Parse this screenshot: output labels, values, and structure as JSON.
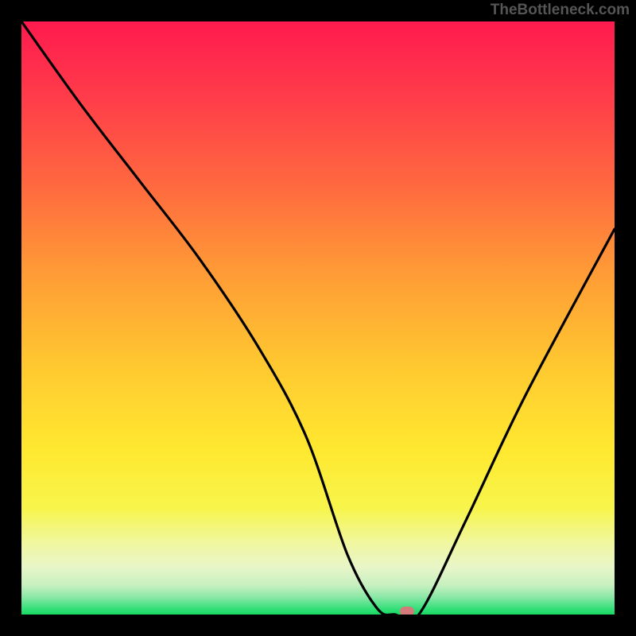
{
  "attribution": "TheBottleneck.com",
  "chart_data": {
    "type": "line",
    "title": "",
    "xlabel": "",
    "ylabel": "",
    "xlim": [
      0,
      100
    ],
    "ylim": [
      0,
      100
    ],
    "x": [
      0,
      10,
      20,
      30,
      40,
      48,
      55,
      60,
      63,
      67,
      75,
      85,
      100
    ],
    "values": [
      100,
      86,
      73,
      60,
      45,
      30,
      10,
      1,
      0,
      0,
      16,
      37,
      65
    ],
    "marker": {
      "x": 65,
      "y": 0.5
    },
    "background": "heatmap-vertical-gradient",
    "colors": {
      "top": "#ff1a4f",
      "mid": "#ffe82f",
      "bottom": "#17d862",
      "line": "#000000",
      "marker": "#d57a7a"
    }
  }
}
